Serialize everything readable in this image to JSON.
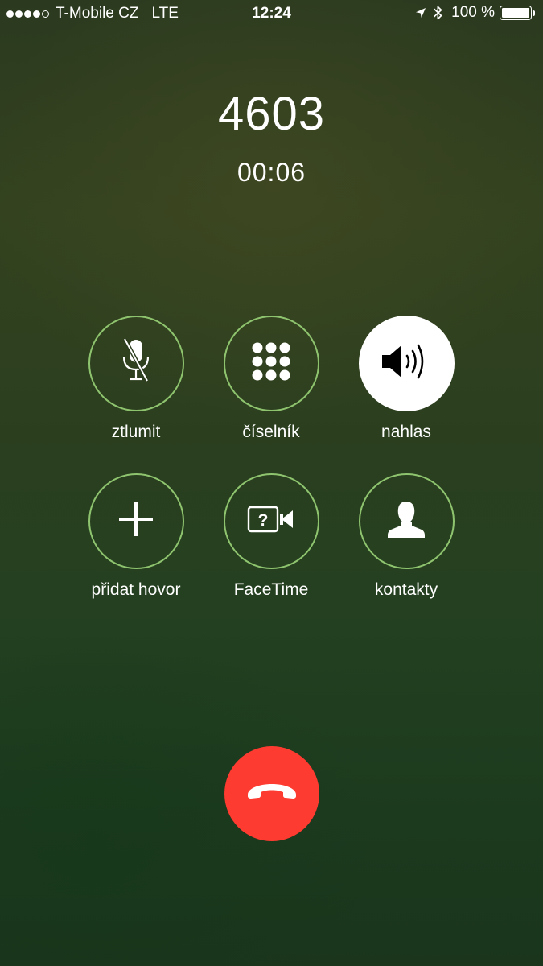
{
  "status_bar": {
    "signal_bars_filled": 4,
    "signal_bars_total": 5,
    "carrier": "T-Mobile CZ",
    "network": "LTE",
    "time": "12:24",
    "battery_label": "100 %",
    "battery_level": 1.0,
    "icons": [
      "location-arrow-icon",
      "bluetooth-icon",
      "battery-icon"
    ]
  },
  "call": {
    "callee": "4603",
    "duration": "00:06"
  },
  "buttons": {
    "mute": {
      "label": "ztlumit",
      "icon": "mic-muted-icon"
    },
    "keypad": {
      "label": "číselník",
      "icon": "keypad-icon"
    },
    "speaker": {
      "label": "nahlas",
      "icon": "speaker-icon",
      "active": true
    },
    "add_call": {
      "label": "přidat hovor",
      "icon": "plus-icon"
    },
    "facetime": {
      "label": "FaceTime",
      "icon": "facetime-icon"
    },
    "contacts": {
      "label": "kontakty",
      "icon": "contact-icon"
    },
    "end_call": {
      "icon": "hang-up-icon"
    }
  },
  "colors": {
    "ring": "#8fc46f",
    "end_call": "#fe3b30",
    "active_fill": "#ffffff"
  }
}
